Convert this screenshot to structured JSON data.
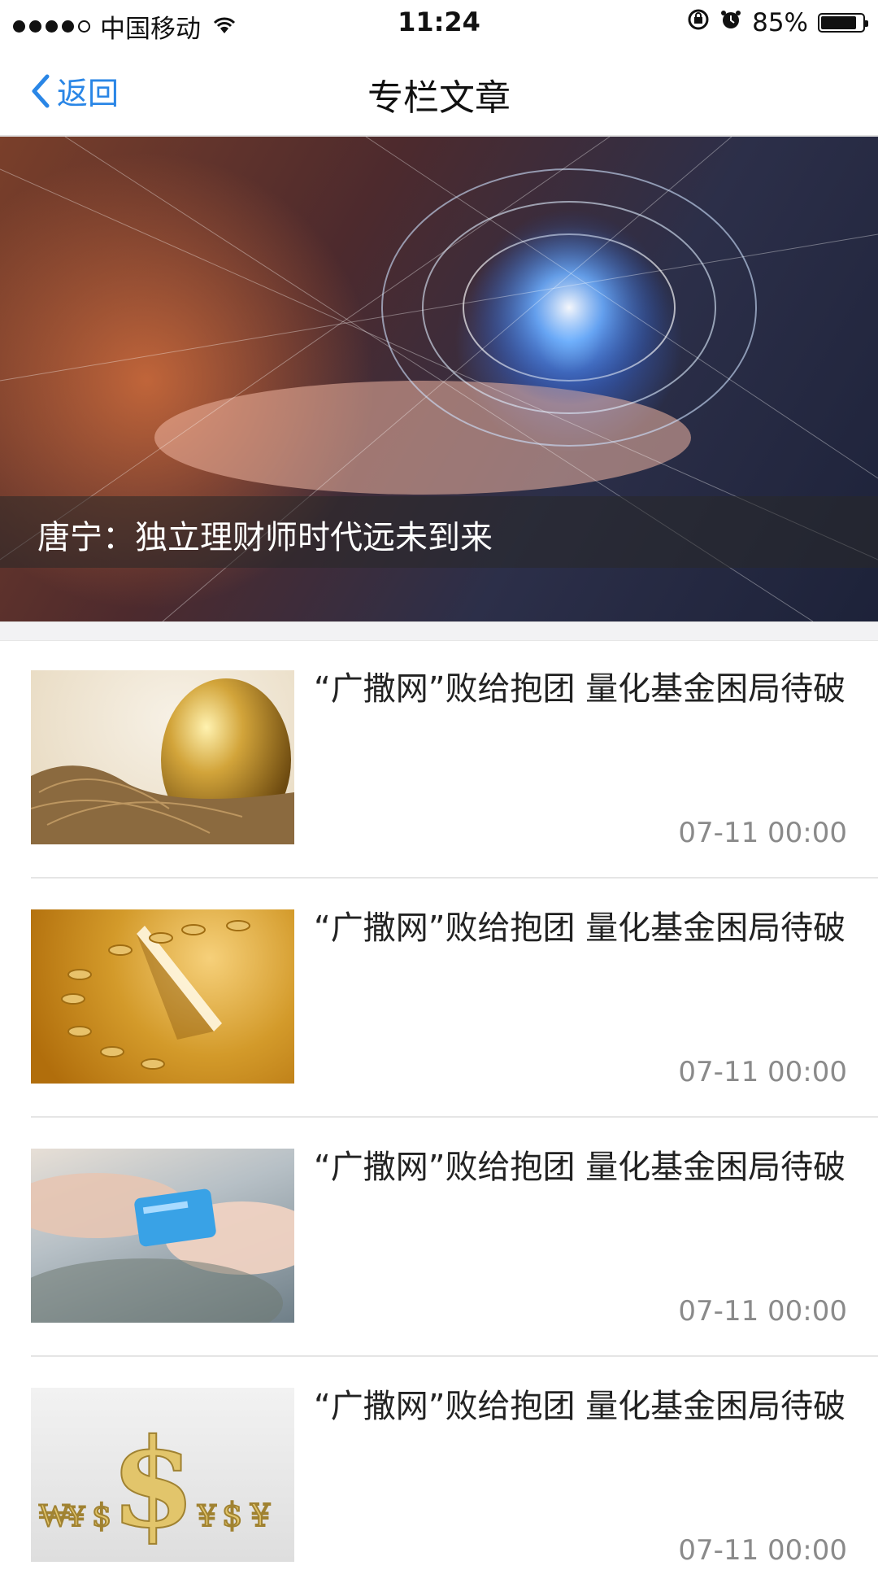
{
  "status_bar": {
    "carrier": "中国移动",
    "time": "11:24",
    "battery_percent": "85%",
    "battery_level": 0.85,
    "signal_dots_filled": 4,
    "signal_dots_total": 5,
    "icons": [
      "wifi-icon",
      "rotation-lock-icon",
      "alarm-icon",
      "battery-icon"
    ]
  },
  "navbar": {
    "back_label": "返回",
    "title": "专栏文章",
    "accent_color": "#2a86e6"
  },
  "hero": {
    "caption": "唐宁：独立理财师时代远未到来"
  },
  "articles": [
    {
      "title": "“广撒网”败给抱团 量化基金困局待破",
      "date": "07-11 00:00",
      "image": "golden-egg"
    },
    {
      "title": "“广撒网”败给抱团 量化基金困局待破",
      "date": "07-11 00:00",
      "image": "gold-coins-sundial"
    },
    {
      "title": "“广撒网”败给抱团 量化基金困局待破",
      "date": "07-11 00:00",
      "image": "card-handover"
    },
    {
      "title": "“广撒网”败给抱团 量化基金困局待破",
      "date": "07-11 00:00",
      "image": "currency-symbols"
    }
  ]
}
